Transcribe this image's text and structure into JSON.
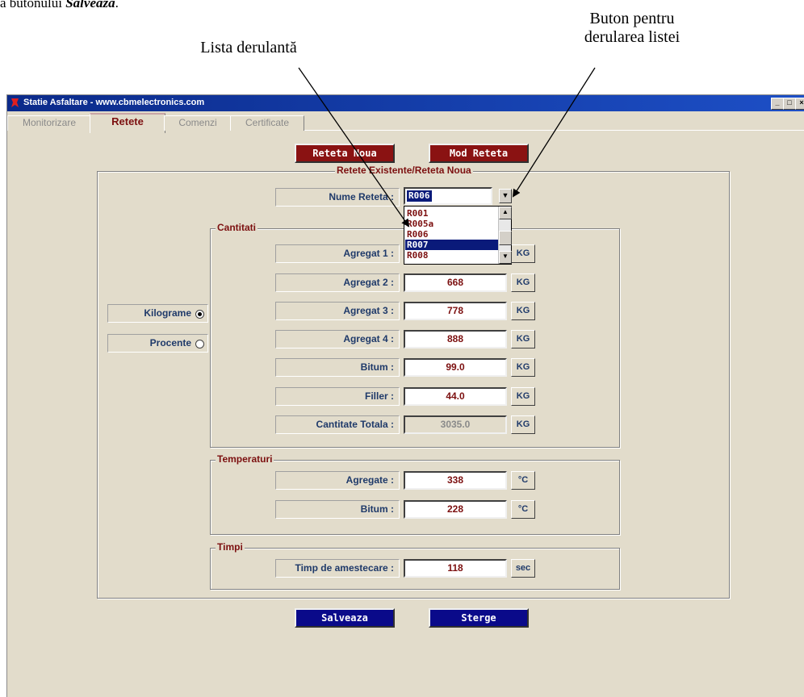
{
  "document": {
    "top_text_prefix": "a butonului ",
    "top_text_bold": "Salvează",
    "top_text_suffix": ".",
    "callout_list": "Lista derulantă",
    "callout_button_line1": "Buton pentru",
    "callout_button_line2": "derularea listei"
  },
  "window": {
    "title": "Statie Asfaltare - www.cbmelectronics.com",
    "controls": [
      "_",
      "□",
      "×"
    ]
  },
  "tabs": [
    {
      "label": "Monitorizare"
    },
    {
      "label": "Retete"
    },
    {
      "label": "Comenzi"
    },
    {
      "label": "Certificate"
    }
  ],
  "actions": {
    "new_recipe": "Reteta Noua",
    "modify_recipe": "Mod Reteta",
    "save": "Salveaza",
    "delete": "Sterge"
  },
  "recipe_group": {
    "title": "Retete Existente/Reteta Noua",
    "name_label": "Nume Reteta :",
    "name_value": "R006",
    "dropdown_options": [
      "R001",
      "R005a",
      "R006",
      "R007",
      "R008"
    ],
    "highlighted_option": "R007"
  },
  "units_mode": {
    "kilograms": "Kilograme",
    "percent": "Procente",
    "selected": "Kilograme"
  },
  "quantities": {
    "title": "Cantitati",
    "rows": [
      {
        "label": "Agregat 1 :",
        "value": "",
        "unit": "KG"
      },
      {
        "label": "Agregat 2 :",
        "value": "668",
        "unit": "KG"
      },
      {
        "label": "Agregat 3 :",
        "value": "778",
        "unit": "KG"
      },
      {
        "label": "Agregat 4 :",
        "value": "888",
        "unit": "KG"
      },
      {
        "label": "Bitum :",
        "value": "99.0",
        "unit": "KG"
      },
      {
        "label": "Filler :",
        "value": "44.0",
        "unit": "KG"
      },
      {
        "label": "Cantitate Totala :",
        "value": "3035.0",
        "unit": "KG"
      }
    ]
  },
  "temperatures": {
    "title": "Temperaturi",
    "rows": [
      {
        "label": "Agregate :",
        "value": "338",
        "unit": "°C"
      },
      {
        "label": "Bitum :",
        "value": "228",
        "unit": "°C"
      }
    ]
  },
  "times": {
    "title": "Timpi",
    "rows": [
      {
        "label": "Timp de amestecare :",
        "value": "118",
        "unit": "sec"
      }
    ]
  },
  "colors": {
    "accent_red": "#8a1212",
    "accent_blue": "#0a0a8a",
    "window_bg": "#e2dccb",
    "label_text": "#1f3a6a",
    "value_text": "#7c1010"
  }
}
